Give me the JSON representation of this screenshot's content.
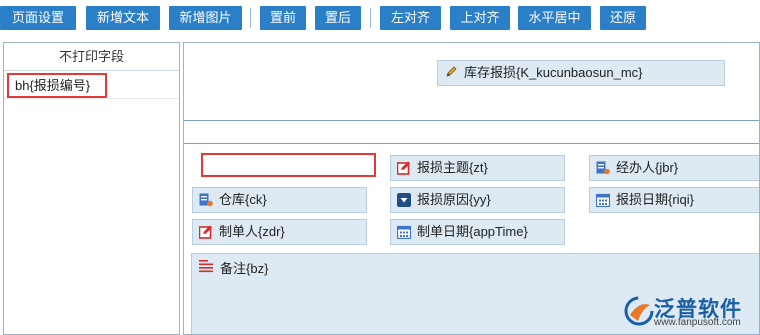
{
  "toolbar": {
    "buttons": [
      "页面设置",
      "新增文本",
      "新增图片",
      "置前",
      "置后",
      "左对齐",
      "上对齐",
      "水平居中",
      "还原"
    ]
  },
  "left_panel": {
    "header": "不打印字段",
    "fields": [
      "bh{报损编号}"
    ]
  },
  "canvas": {
    "title_field": "库存报损{K_kucunbaosun_mc}",
    "fields": {
      "theme": "报损主题{zt}",
      "handler": "经办人{jbr}",
      "warehouse": "仓库{ck}",
      "reason": "报损原因{yy}",
      "date": "报损日期{riqi}",
      "creator": "制单人{zdr}",
      "create_date": "制单日期{appTime}",
      "remark": "备注{bz}"
    }
  },
  "logo": {
    "name": "泛普软件",
    "url": "www.fanpusoft.com"
  },
  "colors": {
    "toolbar_button": "#2b7fc6",
    "field_bg": "#dde9f3",
    "highlight": "#e53935",
    "logo_blue": "#1a5ea8"
  }
}
